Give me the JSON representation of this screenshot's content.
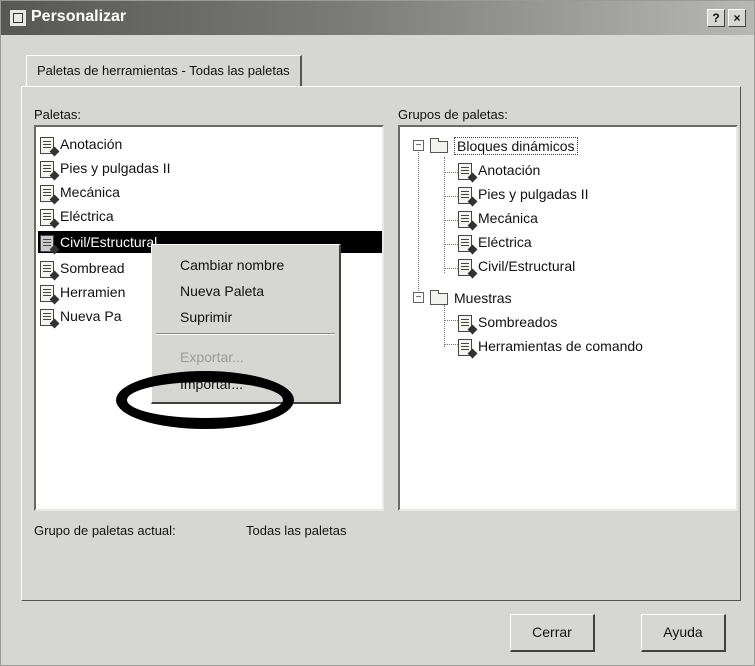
{
  "window": {
    "title": "Personalizar",
    "help_label": "?",
    "close_label": "×"
  },
  "tab": {
    "label": "Paletas de herramientas - Todas las paletas"
  },
  "palettes": {
    "label": "Paletas:",
    "items": [
      {
        "label": "Anotación"
      },
      {
        "label": "Pies y pulgadas II"
      },
      {
        "label": "Mecánica"
      },
      {
        "label": "Eléctrica"
      },
      {
        "label": "Civil/Estructural"
      },
      {
        "label": "Sombread"
      },
      {
        "label": "Herramien"
      },
      {
        "label": "Nueva Pa"
      }
    ],
    "selected_index": 4
  },
  "groups": {
    "label": "Grupos de paletas:",
    "tree": [
      {
        "label": "Bloques dinámicos",
        "children": [
          "Anotación",
          "Pies y pulgadas II",
          "Mecánica",
          "Eléctrica",
          "Civil/Estructural"
        ]
      },
      {
        "label": "Muestras",
        "children": [
          "Sombreados",
          "Herramientas de comando"
        ]
      }
    ]
  },
  "context_menu": {
    "items": [
      {
        "label": "Cambiar nombre",
        "enabled": true
      },
      {
        "label": "Nueva Paleta",
        "enabled": true
      },
      {
        "label": "Suprimir",
        "enabled": true
      },
      {
        "label": "Exportar...",
        "enabled": false
      },
      {
        "label": "Importar...",
        "enabled": true
      }
    ]
  },
  "current_group": {
    "label": "Grupo de paletas actual:",
    "value": "Todas las paletas"
  },
  "buttons": {
    "close": "Cerrar",
    "help": "Ayuda"
  },
  "colors": {
    "selection": "#000000",
    "dialog_bg": "#d6d6d3",
    "annotation_ring": "#000000"
  }
}
